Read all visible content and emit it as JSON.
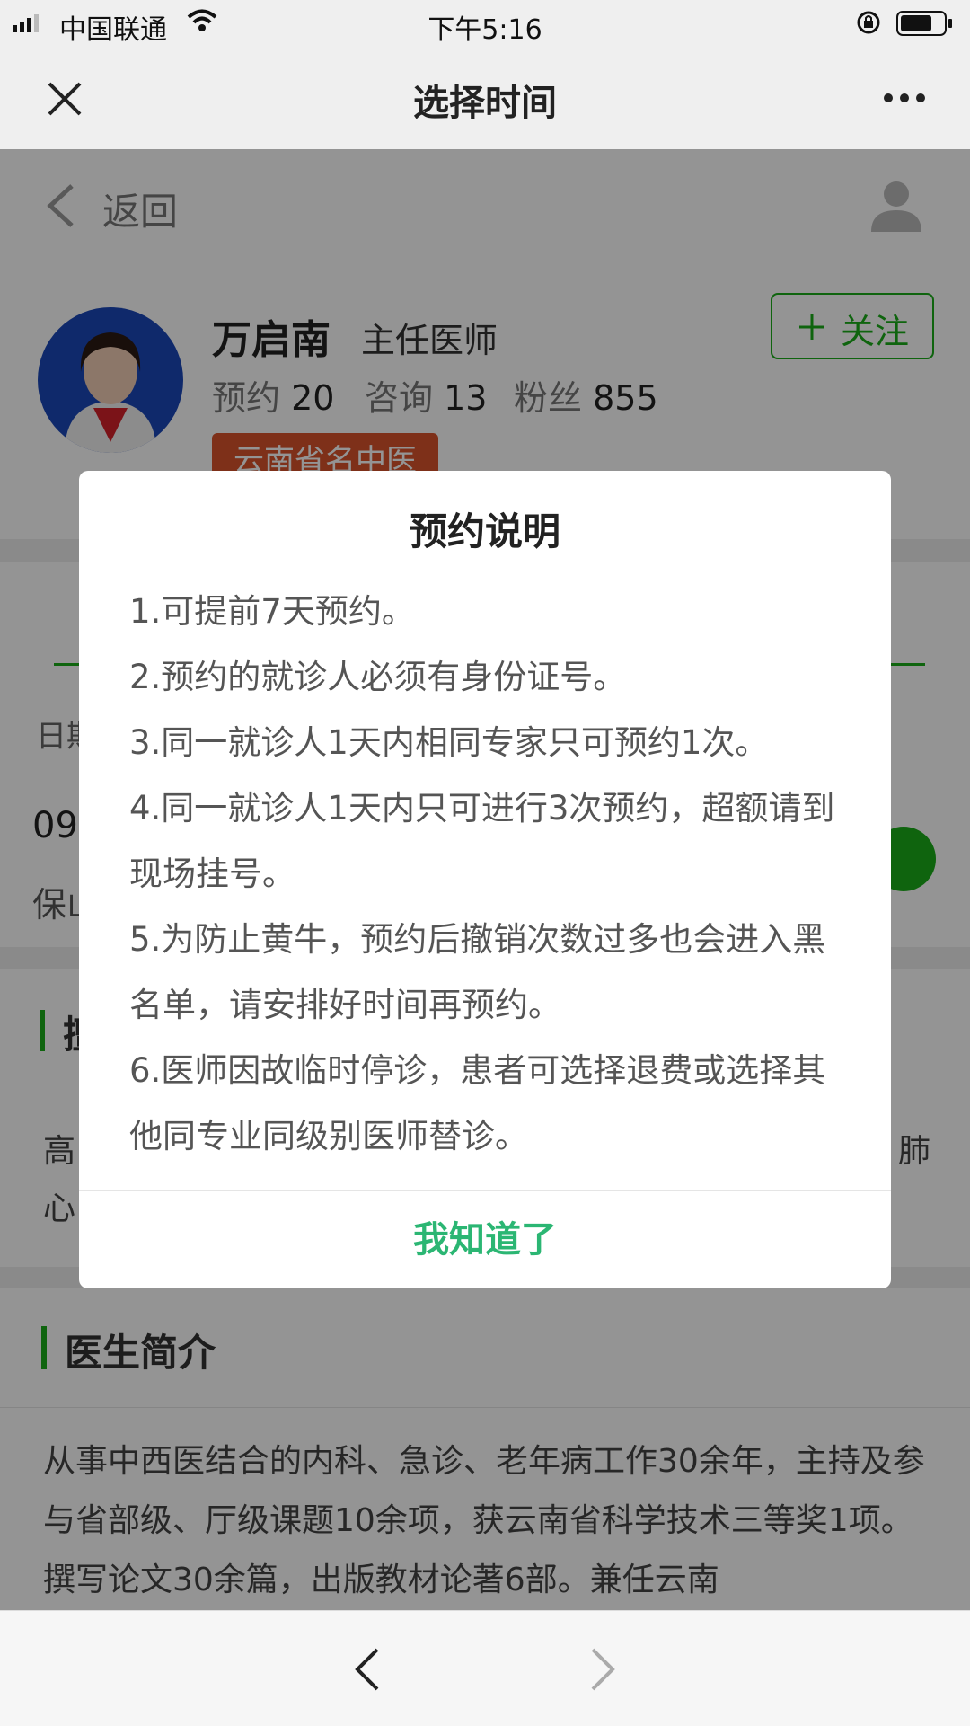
{
  "status_bar": {
    "carrier": "中国联通",
    "time": "下午5:16"
  },
  "nav": {
    "title": "选择时间"
  },
  "page": {
    "back_label": "返回",
    "doctor": {
      "name": "万启南",
      "title": "主任医师",
      "stats": [
        {
          "label": "预约",
          "value": "20"
        },
        {
          "label": "咨询",
          "value": "13"
        },
        {
          "label": "粉丝",
          "value": "855"
        }
      ],
      "badge": "云南省名中医"
    },
    "follow_label": "关注",
    "date_label_partial": "日期",
    "slot_date_partial": "09",
    "slot_place_partial": "保山",
    "section_partial": "擅",
    "specialty_partial_1": "高",
    "specialty_partial_2": "心",
    "specialty_partial_right": "肺",
    "intro_heading": "医生简介",
    "intro_text": "从事中西医结合的内科、急诊、老年病工作30余年，主持及参与省部级、厅级课题10余项，获云南省科学技术三等奖1项。撰写论文30余篇，出版教材论著6部。兼任云南"
  },
  "dialog": {
    "title": "预约说明",
    "rules": [
      "1.可提前7天预约。",
      "2.预约的就诊人必须有身份证号。",
      "3.同一就诊人1天内相同专家只可预约1次。",
      "4.同一就诊人1天内只可进行3次预约，超额请到现场挂号。",
      "5.为防止黄牛，预约后撤销次数过多也会进入黑名单，请安排好时间再预约。",
      "6.医师因故临时停诊，患者可选择退费或选择其他同专业同级别医师替诊。"
    ],
    "confirm_label": "我知道了"
  },
  "colors": {
    "accent_green": "#1aad19",
    "badge_red": "#d9532b",
    "dialog_button": "#2bb673"
  },
  "icons": [
    "close-icon",
    "more-icon",
    "back-chevron-icon",
    "user-icon",
    "plus-icon",
    "browser-back-icon",
    "browser-forward-icon",
    "signal-icon",
    "wifi-icon",
    "rotation-lock-icon",
    "battery-icon"
  ]
}
